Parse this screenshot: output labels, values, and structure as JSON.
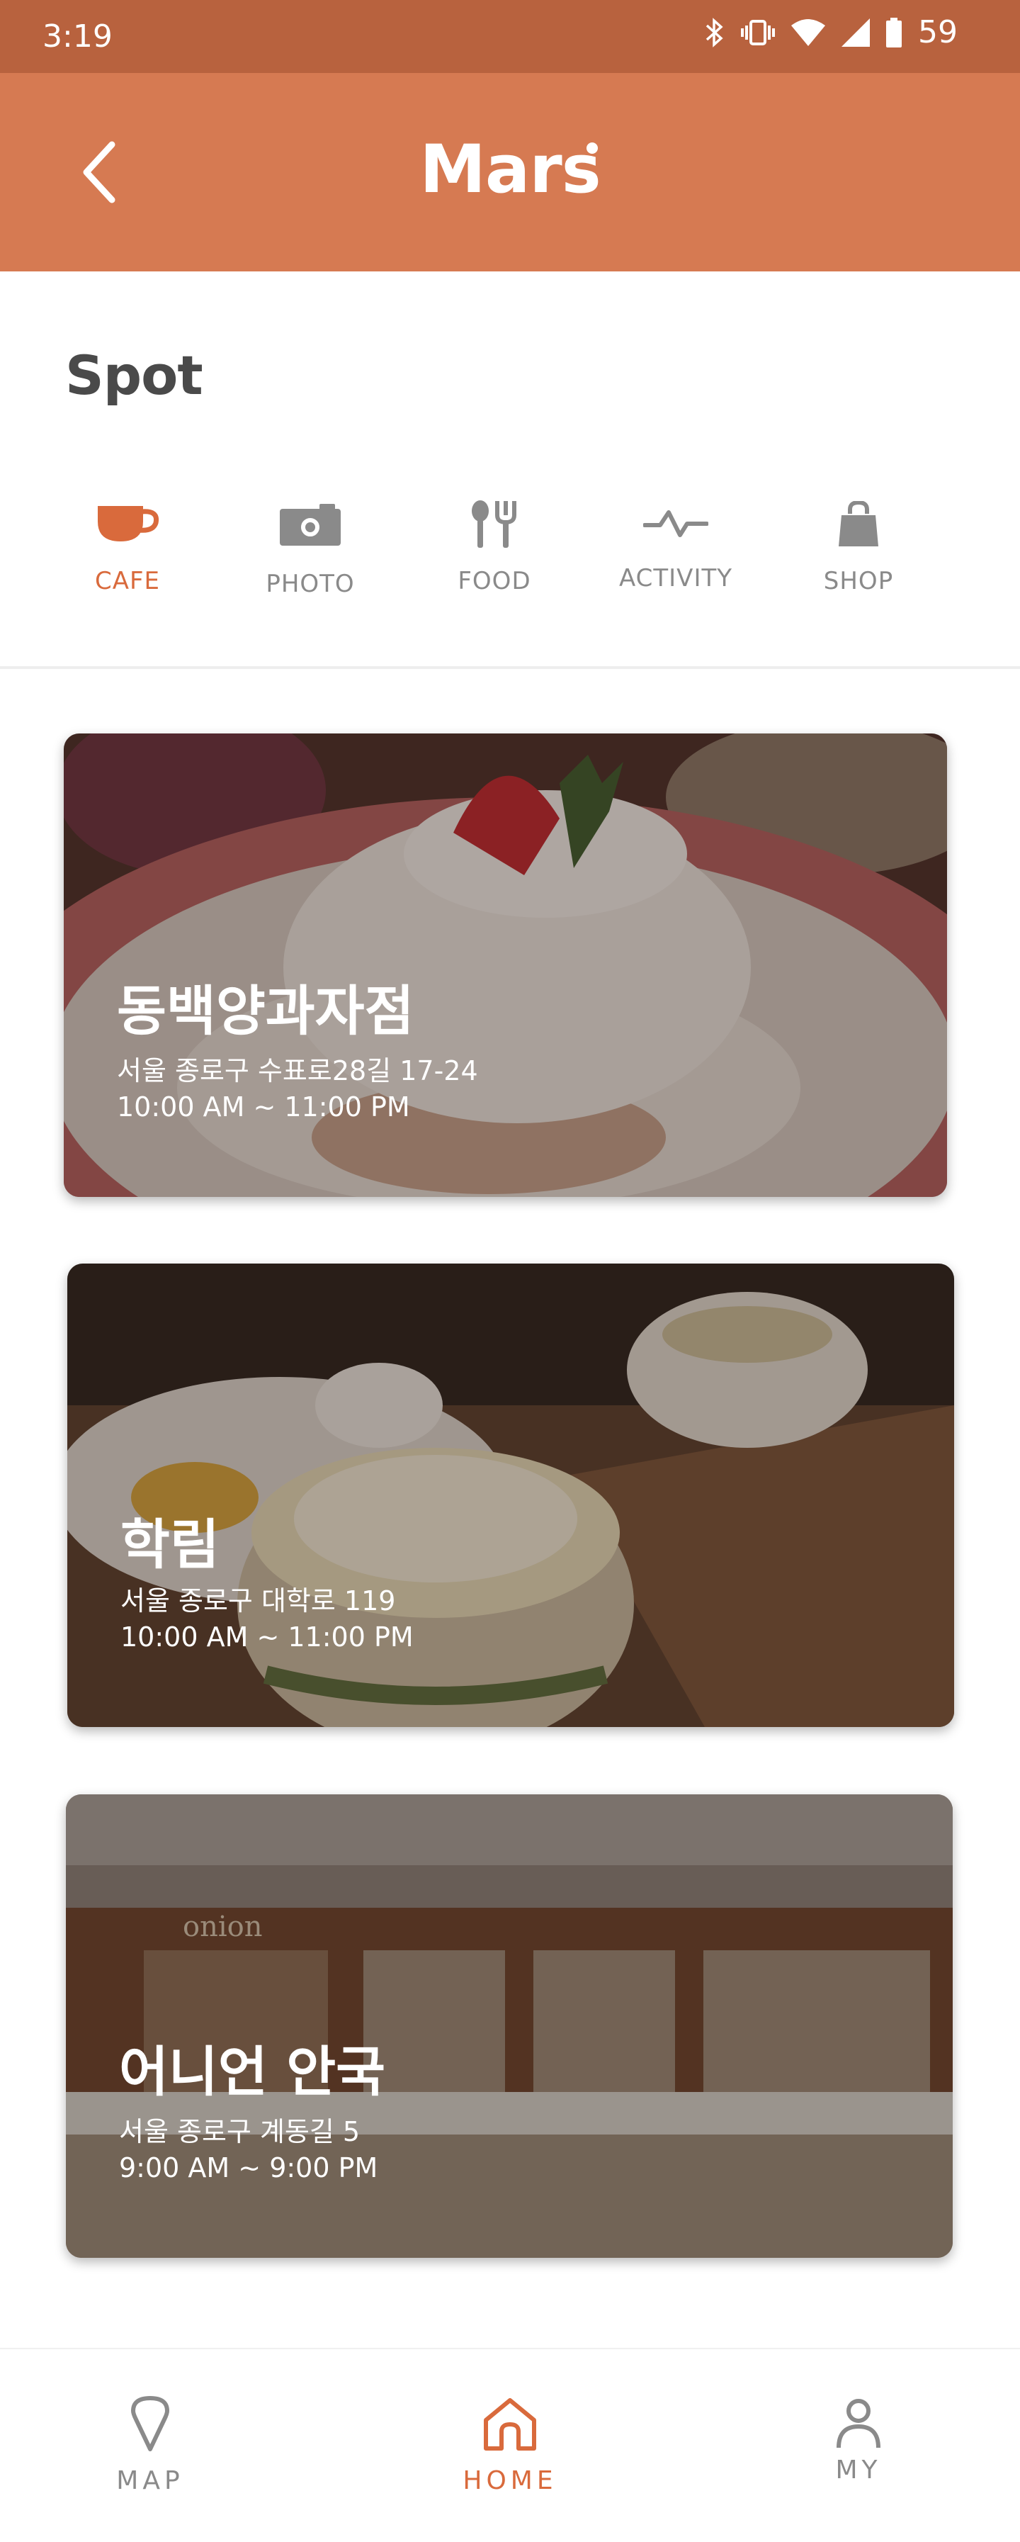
{
  "status_bar": {
    "time": "3:19",
    "battery": "59"
  },
  "app_bar": {
    "title": "Mars"
  },
  "section": {
    "title": "Spot"
  },
  "categories": [
    {
      "label": "CAFE",
      "icon": "coffee-cup-icon",
      "active": true
    },
    {
      "label": "PHOTO",
      "icon": "camera-icon",
      "active": false
    },
    {
      "label": "FOOD",
      "icon": "fork-knife-icon",
      "active": false
    },
    {
      "label": "ACTIVITY",
      "icon": "activity-icon",
      "active": false
    },
    {
      "label": "SHOP",
      "icon": "shopping-bag-icon",
      "active": false
    }
  ],
  "spots": [
    {
      "name": "동백양과자점",
      "address": "서울 종로구 수표로28길 17-24",
      "hours": "10:00 AM ~ 11:00 PM"
    },
    {
      "name": "학림",
      "address": "서울 종로구 대학로 119",
      "hours": "10:00 AM ~ 11:00 PM"
    },
    {
      "name": "어니언 안국",
      "address": "서울 종로구 계동길 5",
      "hours": "9:00 AM ~ 9:00 PM"
    }
  ],
  "card_image_text": "onion",
  "bottom_nav": [
    {
      "label": "MAP",
      "icon": "map-pin-icon",
      "active": false
    },
    {
      "label": "HOME",
      "icon": "home-icon",
      "active": true
    },
    {
      "label": "MY",
      "icon": "user-icon",
      "active": false
    }
  ],
  "colors": {
    "accent": "#d96a3c",
    "app_bar": "#d67a52",
    "status_bar": "#b8623e",
    "inactive": "#8a8a8a"
  }
}
